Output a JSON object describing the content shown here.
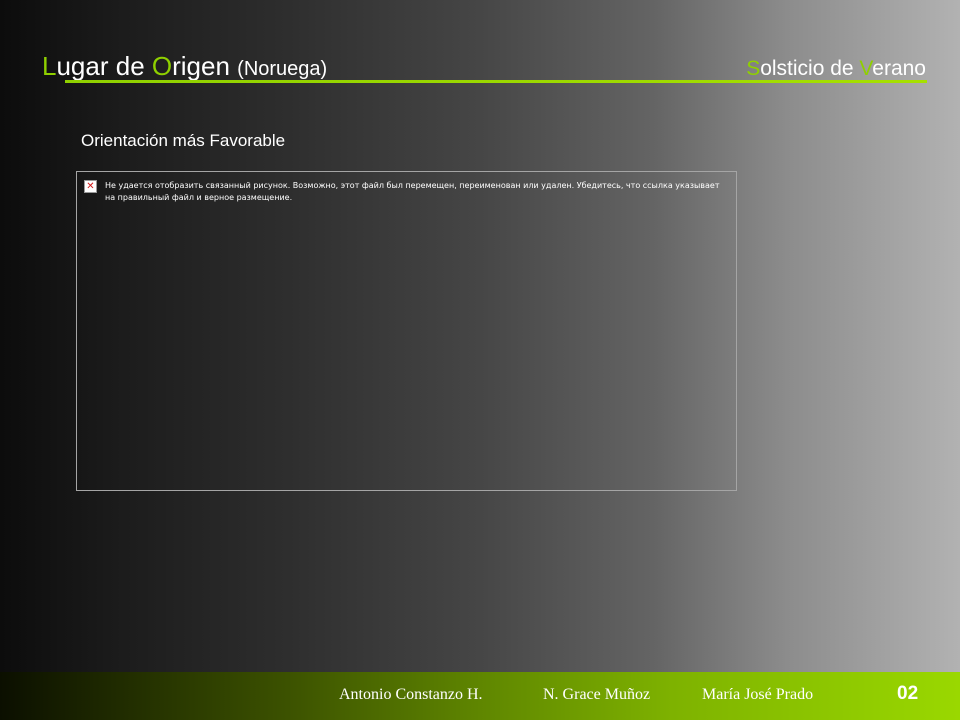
{
  "header": {
    "title_parts": {
      "l_initial": "L",
      "l_rest": "ugar de ",
      "o_initial": "O",
      "o_rest": "rigen ",
      "paren": "(Noruega)"
    },
    "subtitle_parts": {
      "s_initial": "S",
      "s_rest": "olsticio de ",
      "v_initial": "V",
      "v_rest": "erano"
    }
  },
  "content": {
    "heading": "Orientación más Favorable",
    "image_placeholder": {
      "icon": "broken-image-icon",
      "icon_glyph": "✕",
      "message": "Не удается отобразить связанный рисунок. Возможно, этот файл был перемещен, переименован или удален. Убедитесь, что ссылка указывает на правильный файл и верное размещение."
    }
  },
  "footer": {
    "authors": [
      "Antonio Constanzo H.",
      "N. Grace Muñoz",
      "María José Prado"
    ],
    "page_number": "02"
  },
  "colors": {
    "accent_green": "#8fd000",
    "text": "#ffffff",
    "frame_border": "#a5a5a5"
  }
}
